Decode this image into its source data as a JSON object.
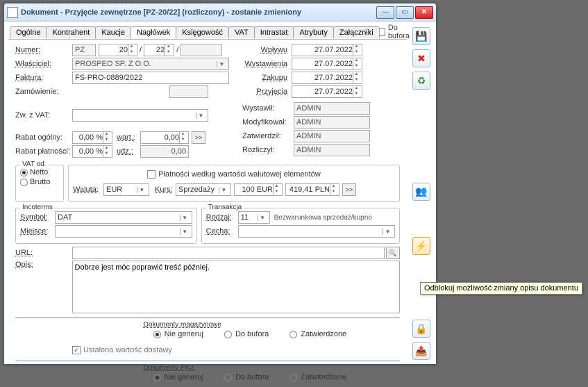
{
  "title": "Dokument - Przyjęcie zewnętrzne [PZ-20/22] (rozliczony) - zostanie zmieniony",
  "tabs": [
    "Ogólne",
    "Kontrahent",
    "Kaucje",
    "Nagłówek",
    "Księgowość",
    "VAT",
    "Intrastat",
    "Atrybuty",
    "Załączniki"
  ],
  "activeTab": 3,
  "buforaLabel": "Do bufora",
  "labels": {
    "numer": "Numer:",
    "pz": "PZ",
    "n1": "20",
    "n2": "22",
    "wlasciciel": "Właściciel:",
    "wlascicielVal": "PROSPEO SP. Z O.O.",
    "faktura": "Faktura:",
    "fakturaVal": "FS-PRO-0889/2022",
    "zamowienie": "Zamówienie:",
    "wplywu": "Wpływu",
    "wystawienia": "Wystawienia",
    "zakupu": "Zakupu",
    "przyjecia": "Przyjęcia",
    "date": "27.07.2022",
    "wystawil": "Wystawił:",
    "modyfikowal": "Modyfikował:",
    "zatwierdzil": "Zatwierdził:",
    "rozliczyl": "Rozliczył:",
    "admin": "ADMIN",
    "zwzvat": "Zw. z VAT:",
    "rabatOgolny": "Rabat ogólny:",
    "rabatOgolnyVal": "0,00 %",
    "wart": "wart.:",
    "wartVal": "0,00",
    "rabatPlat": "Rabat płatności:",
    "rabatPlatVal": "0,00 %",
    "udz": "udz.:",
    "udzVal": "0,00",
    "vatOd": "VAT od:",
    "netto": "Netto",
    "brutto": "Brutto",
    "platnosciCheck": "Płatności według wartości walutowej elementów",
    "waluta": "Waluta:",
    "walutaVal": "EUR",
    "kurs": "Kurs:",
    "kursType": "Sprzedaży",
    "kursEur": "100 EUR",
    "kursPln": "419,41 PLN",
    "incoterms": "Incoterms",
    "symbol": "Symbol:",
    "symbolVal": "DAT",
    "miejsce": "Miejsce:",
    "transakcja": "Transakcja",
    "rodzaj": "Rodzaj:",
    "rodzajVal": "11",
    "rodzajDesc": "Bezwarunkowa sprzedaż/kupno",
    "cecha": "Cecha:",
    "url": "URL:",
    "opis": "Opis:",
    "opisVal": "Dobrze jest móc poprawić treść później.",
    "dokMag": "Dokumenty magazynowe",
    "dokPKJ": "Dokumenty PKJ:",
    "nieGeneruj": "Nie generuj",
    "doBufora": "Do bufora",
    "zatwierdzone": "Zatwierdzone",
    "ustalona": "Ustalona wartość dostawy",
    "arrow": ">>"
  },
  "tooltip": "Odblokuj możliwość zmiany opisu dokumentu"
}
